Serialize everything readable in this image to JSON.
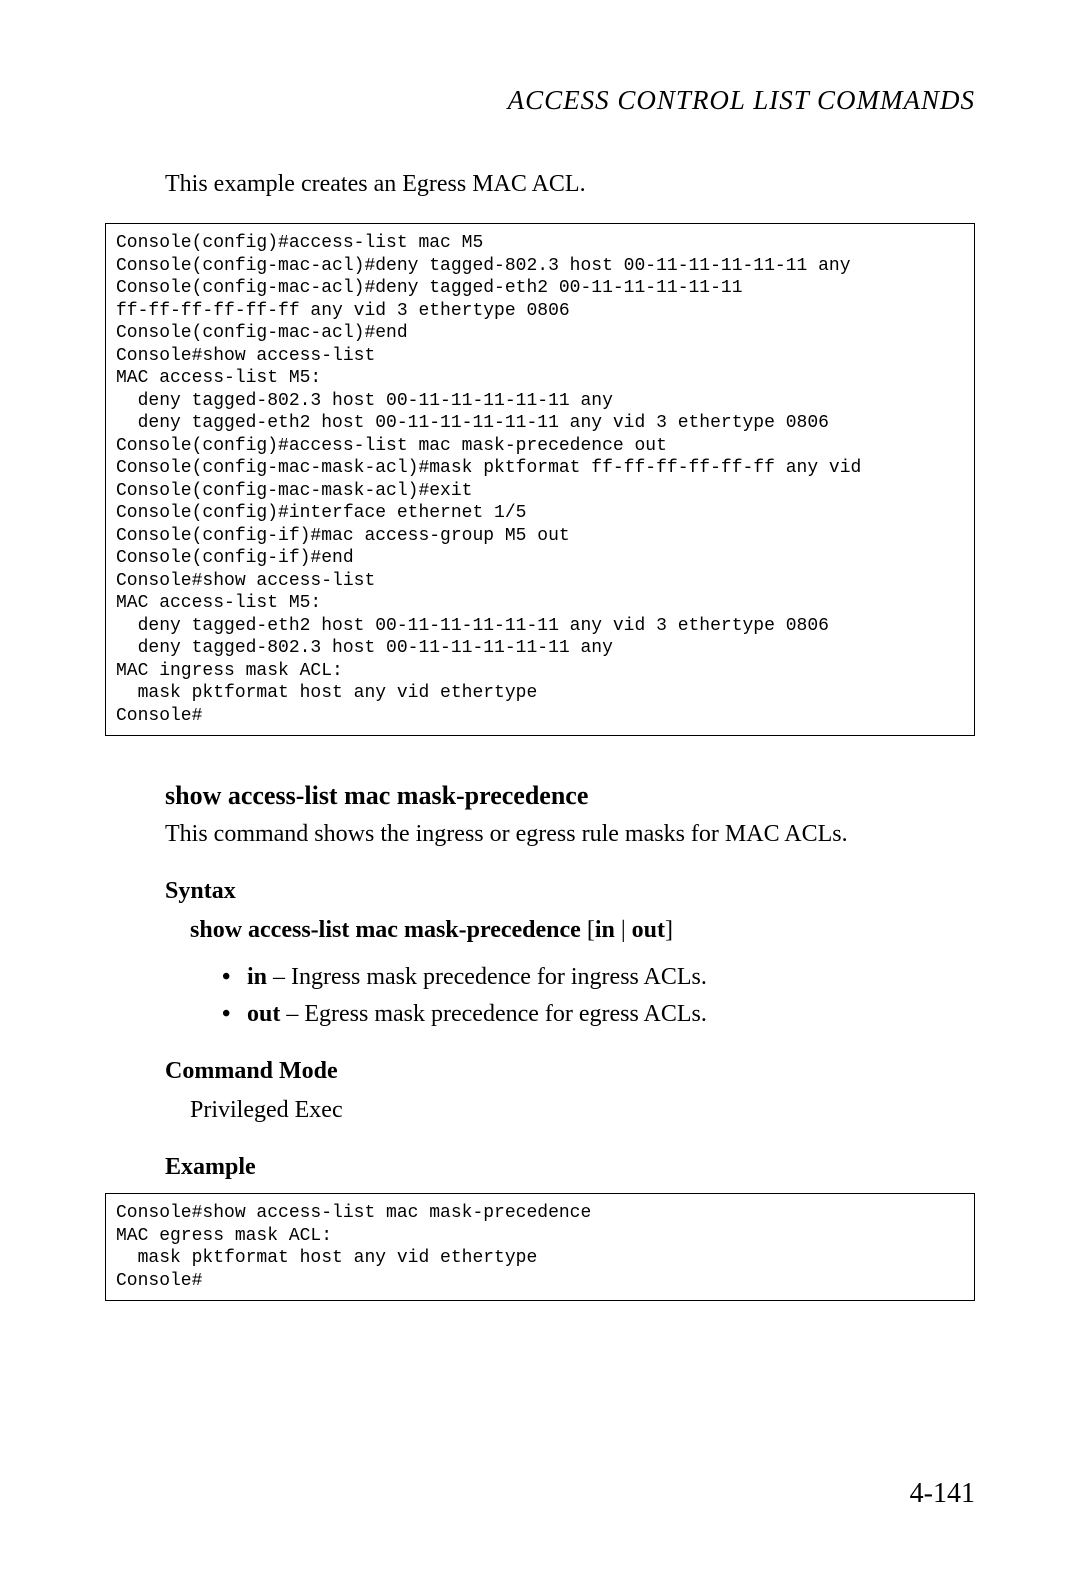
{
  "header": {
    "title": "ACCESS CONTROL LIST COMMANDS"
  },
  "intro": "This example creates an Egress MAC ACL.",
  "codeblock1": "Console(config)#access-list mac M5\nConsole(config-mac-acl)#deny tagged-802.3 host 00-11-11-11-11-11 any\nConsole(config-mac-acl)#deny tagged-eth2 00-11-11-11-11-11 \nff-ff-ff-ff-ff-ff any vid 3 ethertype 0806\nConsole(config-mac-acl)#end\nConsole#show access-list\nMAC access-list M5:\n  deny tagged-802.3 host 00-11-11-11-11-11 any\n  deny tagged-eth2 host 00-11-11-11-11-11 any vid 3 ethertype 0806\nConsole(config)#access-list mac mask-precedence out\nConsole(config-mac-mask-acl)#mask pktformat ff-ff-ff-ff-ff-ff any vid\nConsole(config-mac-mask-acl)#exit\nConsole(config)#interface ethernet 1/5\nConsole(config-if)#mac access-group M5 out\nConsole(config-if)#end\nConsole#show access-list\nMAC access-list M5:\n  deny tagged-eth2 host 00-11-11-11-11-11 any vid 3 ethertype 0806\n  deny tagged-802.3 host 00-11-11-11-11-11 any\nMAC ingress mask ACL:\n  mask pktformat host any vid ethertype\nConsole#",
  "section": {
    "title": "show access-list mac mask-precedence",
    "desc": "This command shows the ingress or egress rule masks for MAC ACLs."
  },
  "syntax": {
    "label": "Syntax",
    "cmd_bold": "show access-list mac mask-precedence",
    "cmd_rest_open": " [",
    "cmd_in": "in",
    "cmd_pipe": " | ",
    "cmd_out": "out",
    "cmd_close": "]"
  },
  "bullets": [
    {
      "bold": "in",
      "rest": " – Ingress mask precedence for ingress ACLs."
    },
    {
      "bold": "out",
      "rest": " – Egress mask precedence for egress ACLs."
    }
  ],
  "command_mode": {
    "label": "Command Mode",
    "value": "Privileged Exec"
  },
  "example_label": "Example",
  "codeblock2": "Console#show access-list mac mask-precedence\nMAC egress mask ACL:\n  mask pktformat host any vid ethertype\nConsole#",
  "page_number": "4-141"
}
